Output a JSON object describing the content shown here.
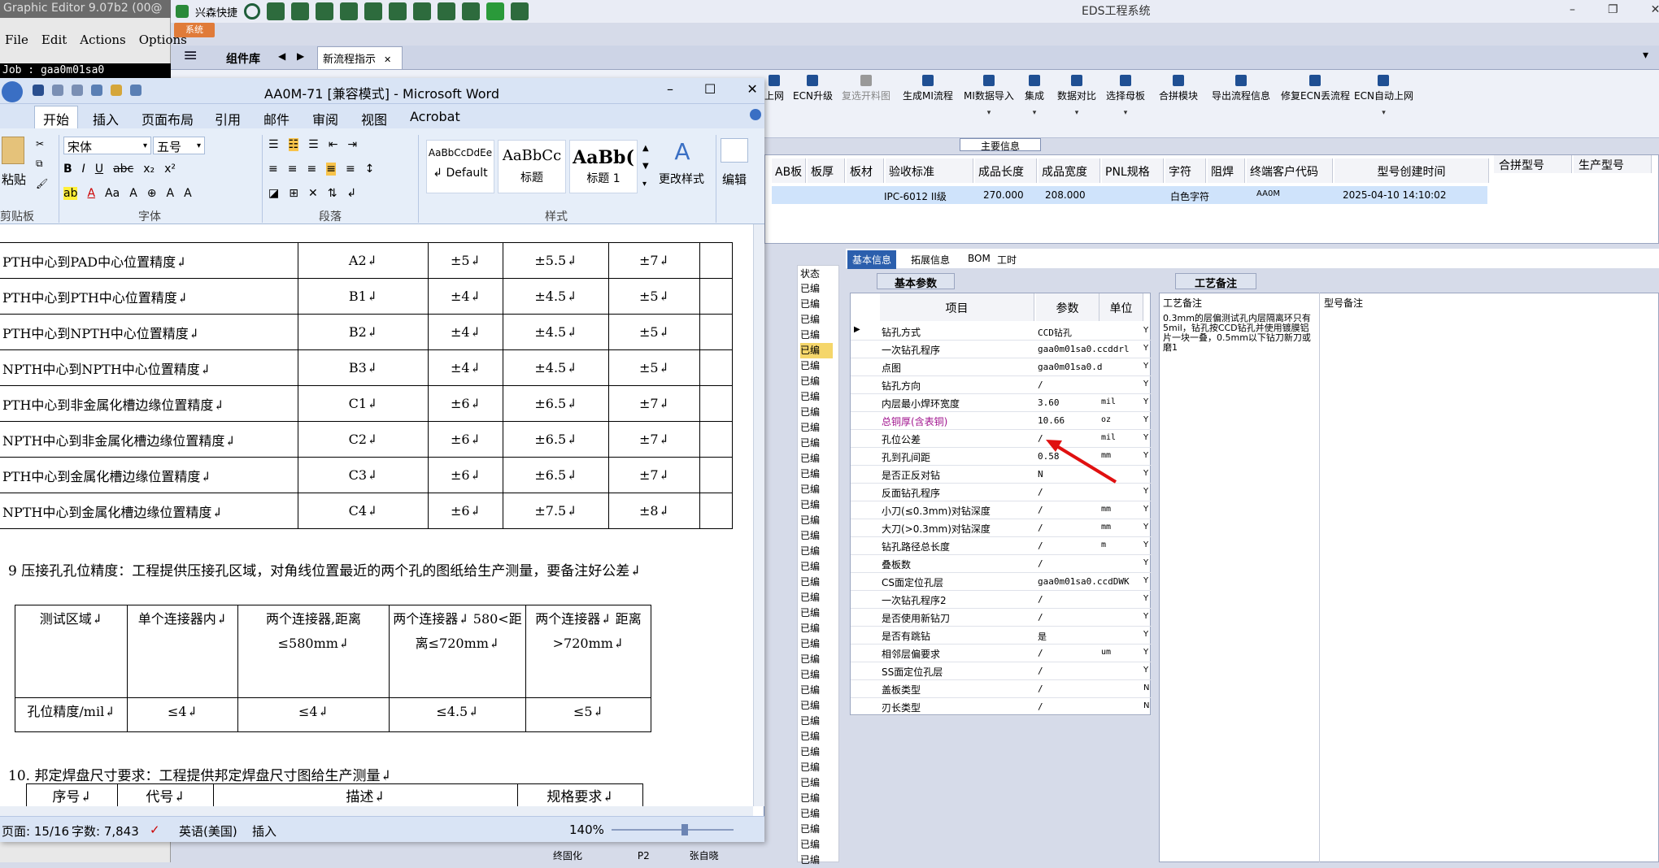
{
  "graphic_editor": {
    "title": "Graphic Editor 9.07b2 (00@",
    "menu": [
      "File",
      "Edit",
      "Actions",
      "Options"
    ],
    "job": "Job : gaa0m01sa0"
  },
  "eds": {
    "title": "EDS工程系统",
    "toolbar_app": "兴森快捷",
    "sys_tag": "系统",
    "component_lib": "组件库",
    "active_tab": "新流程指示",
    "tools": [
      "上网",
      "ECN升级",
      "复选开料图",
      "生成MI流程",
      "MI数据导入",
      "集成",
      "数据对比",
      "选择母板",
      "合拼模块",
      "导出流程信息",
      "修复ECN丢流程",
      "ECN自动上网"
    ],
    "main_info": "主要信息",
    "grid": {
      "headers": [
        "AB板",
        "板厚",
        "板材",
        "验收标准",
        "成品长度",
        "成品宽度",
        "PNL规格",
        "字符",
        "阻焊",
        "终端客户代码",
        "型号创建时间",
        "合拼型号",
        "生产型号"
      ],
      "row": [
        "IPC-6012 II级",
        "270.000",
        "208.000",
        "白色字符",
        "AA0M",
        "2025-04-10 14:10:02"
      ]
    },
    "info_tabs": [
      "基本信息",
      "拓展信息",
      "BOM",
      "工时"
    ],
    "basic_params_title": "基本参数",
    "craft_notes_title": "工艺备注",
    "params_headers": [
      "项目",
      "参数",
      "单位"
    ],
    "params": [
      {
        "item": "钻孔方式",
        "value": "CCD钻孔",
        "unit": "",
        "flag": "Y"
      },
      {
        "item": "一次钻孔程序",
        "value": "gaa0m01sa0.ccddrl",
        "unit": "",
        "flag": "Y"
      },
      {
        "item": "点图",
        "value": "gaa0m01sa0.d",
        "unit": "",
        "flag": "Y"
      },
      {
        "item": "钻孔方向",
        "value": "/",
        "unit": "",
        "flag": "Y"
      },
      {
        "item": "内层最小焊环宽度",
        "value": "3.60",
        "unit": "mil",
        "flag": "Y"
      },
      {
        "item": "总铜厚(含表铜)",
        "value": "10.66",
        "unit": "oz",
        "flag": "Y"
      },
      {
        "item": "孔位公差",
        "value": "/",
        "unit": "mil",
        "flag": "Y"
      },
      {
        "item": "孔到孔间距",
        "value": "0.58",
        "unit": "mm",
        "flag": "Y"
      },
      {
        "item": "是否正反对钻",
        "value": "N",
        "unit": "",
        "flag": "Y"
      },
      {
        "item": "反面钻孔程序",
        "value": "/",
        "unit": "",
        "flag": "Y"
      },
      {
        "item": "小刀(≤0.3mm)对钻深度",
        "value": "/",
        "unit": "mm",
        "flag": "Y"
      },
      {
        "item": "大刀(>0.3mm)对钻深度",
        "value": "/",
        "unit": "mm",
        "flag": "Y"
      },
      {
        "item": "钻孔路径总长度",
        "value": "/",
        "unit": "m",
        "flag": "Y"
      },
      {
        "item": "叠板数",
        "value": "/",
        "unit": "",
        "flag": "Y"
      },
      {
        "item": "CS面定位孔层",
        "value": "gaa0m01sa0.ccdDWK",
        "unit": "",
        "flag": "Y"
      },
      {
        "item": "一次钻孔程序2",
        "value": "/",
        "unit": "",
        "flag": "Y"
      },
      {
        "item": "是否使用新钻刀",
        "value": "/",
        "unit": "",
        "flag": "Y"
      },
      {
        "item": "是否有跳钻",
        "value": "是",
        "unit": "",
        "flag": "Y"
      },
      {
        "item": "相邻层偏要求",
        "value": "/",
        "unit": "um",
        "flag": "Y"
      },
      {
        "item": "SS面定位孔层",
        "value": "/",
        "unit": "",
        "flag": "Y"
      },
      {
        "item": "盖板类型",
        "value": "/",
        "unit": "",
        "flag": "N"
      },
      {
        "item": "刃长类型",
        "value": "/",
        "unit": "",
        "flag": "N"
      }
    ],
    "notes_headers": [
      "工艺备注",
      "型号备注"
    ],
    "notes_text": "0.3mm的层偏测试孔内层隔离环只有5mil，钻孔按CCD钻孔并使用镀膜铝片一块一叠，0.5mm以下钻刀新刀或磨1",
    "status_header": "状态",
    "status_value": "已编",
    "bottom_rows": [
      {
        "a": "终固化",
        "b": "P2",
        "c": "张自晓"
      }
    ]
  },
  "word": {
    "title": "AA0M-71 [兼容模式] - Microsoft Word",
    "tabs": [
      "开始",
      "插入",
      "页面布局",
      "引用",
      "邮件",
      "审阅",
      "视图",
      "Acrobat"
    ],
    "font_name": "宋体",
    "font_size": "五号",
    "clipboard_label": "剪贴板",
    "paste_label": "粘贴",
    "font_group": "字体",
    "para_group": "段落",
    "styles_group": "样式",
    "edit_label": "编辑",
    "change_styles": "更改样式",
    "styles": [
      {
        "sample": "AaBbCcDdEe",
        "name": "↲ Default"
      },
      {
        "sample": "AaBbCc",
        "name": "标题"
      },
      {
        "sample": "AaBb(",
        "name": "标题 1"
      }
    ],
    "table1": [
      [
        "PTH中心到PAD中心位置精度↲",
        "A2↲",
        "±5↲",
        "±5.5↲",
        "±7↲"
      ],
      [
        "PTH中心到PTH中心位置精度↲",
        "B1↲",
        "±4↲",
        "±4.5↲",
        "±5↲"
      ],
      [
        "PTH中心到NPTH中心位置精度↲",
        "B2↲",
        "±4↲",
        "±4.5↲",
        "±5↲"
      ],
      [
        "NPTH中心到NPTH中心位置精度↲",
        "B3↲",
        "±4↲",
        "±4.5↲",
        "±5↲"
      ],
      [
        "PTH中心到非金属化槽边缘位置精度↲",
        "C1↲",
        "±6↲",
        "±6.5↲",
        "±7↲"
      ],
      [
        "NPTH中心到非金属化槽边缘位置精度↲",
        "C2↲",
        "±6↲",
        "±6.5↲",
        "±7↲"
      ],
      [
        "PTH中心到金属化槽边缘位置精度↲",
        "C3↲",
        "±6↲",
        "±6.5↲",
        "±7↲"
      ],
      [
        "NPTH中心到金属化槽边缘位置精度↲",
        "C4↲",
        "±6↲",
        "±7.5↲",
        "±8↲"
      ]
    ],
    "para9": "9 压接孔孔位精度：工程提供压接孔区域，对角线位置最近的两个孔的图纸给生产测量，要备注好公差↲",
    "table2_head": [
      "测试区域↲",
      "单个连接器内↲",
      "两个连接器,距离≤580mm↲",
      "两个连接器↲ 580<距离≤720mm↲",
      "两个连接器↲ 距离>720mm↲"
    ],
    "table2_row": [
      "孔位精度/mil↲",
      "≤4↲",
      "≤4↲",
      "≤4.5↲",
      "≤5↲"
    ],
    "para10": "10. 邦定焊盘尺寸要求：工程提供邦定焊盘尺寸图给生产测量↲",
    "table3_head": [
      "序号↲",
      "代号↲",
      "描述↲",
      "规格要求↲"
    ],
    "status": {
      "page": "页面: 15/16",
      "words": "字数: 7,843",
      "lang": "英语(美国)",
      "mode": "插入",
      "zoom": "140%"
    }
  }
}
